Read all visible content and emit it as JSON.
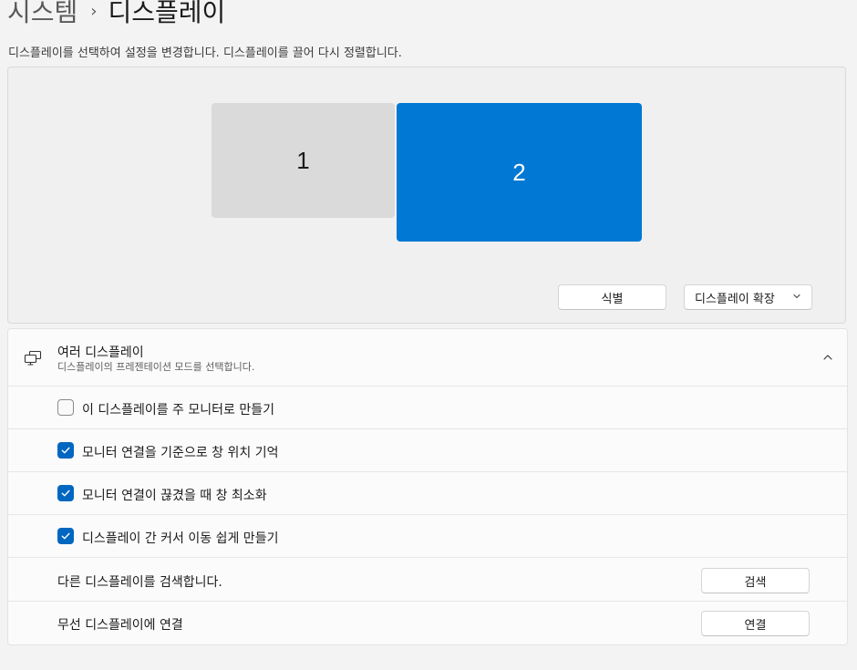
{
  "breadcrumb": {
    "parent": "시스템",
    "separator": "›",
    "current": "디스플레이"
  },
  "instruction": "디스플레이를 선택하여 설정을 변경합니다. 디스플레이를 끌어 다시 정렬합니다.",
  "arrangement": {
    "monitors": [
      {
        "number": "1",
        "selected": false
      },
      {
        "number": "2",
        "selected": true
      }
    ],
    "identify_label": "식별",
    "mode_value": "디스플레이 확장"
  },
  "multiple_displays": {
    "title": "여러 디스플레이",
    "subtitle": "디스플레이의 프레젠테이션 모드를 선택합니다.",
    "expanded": true,
    "options": [
      {
        "label": "이 디스플레이를 주 모니터로 만들기",
        "checked": false
      },
      {
        "label": "모니터 연결을 기준으로 창 위치 기억",
        "checked": true
      },
      {
        "label": "모니터 연결이 끊겼을 때 창 최소화",
        "checked": true
      },
      {
        "label": "디스플레이 간 커서 이동 쉽게 만들기",
        "checked": true
      }
    ],
    "detect": {
      "label": "다른 디스플레이를 검색합니다.",
      "button": "검색"
    },
    "wireless": {
      "label": "무선 디스플레이에 연결",
      "button": "연결"
    }
  },
  "colors": {
    "accent": "#0078d4",
    "checkbox_accent": "#0067c0",
    "page_background": "#f3f3f3"
  },
  "icons": {
    "breadcrumb_separator": "chevron-right-icon",
    "dropdown": "chevron-down-icon",
    "card": "multiple-displays-icon",
    "collapse": "chevron-up-icon",
    "checkmark": "checkmark-icon"
  }
}
